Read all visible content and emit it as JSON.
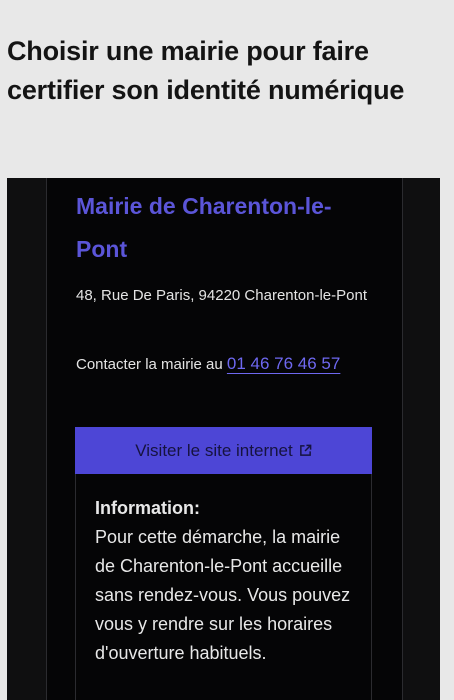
{
  "page": {
    "title": "Choisir une mairie pour faire certifier son identité numérique"
  },
  "mairie": {
    "name": "Mairie de Charenton-le-Pont",
    "address": "48, Rue De Paris, 94220 Charenton-le-Pont",
    "contact_prefix": "Contacter la mairie au ",
    "phone": "01 46 76 46 57",
    "visit_label": "Visiter le site internet",
    "visit_icon": "external-link-icon"
  },
  "info": {
    "title": "Information:",
    "text": "Pour cette démarche, la mairie de Charenton-le-Pont accueille sans rendez-vous. Vous pouvez vous y rendre sur les horaires d'ouverture habituels."
  },
  "colors": {
    "accent": "#4d46d6",
    "link": "#6e68f0",
    "panel_background": "#050506",
    "page_background": "#e8e8e8"
  }
}
